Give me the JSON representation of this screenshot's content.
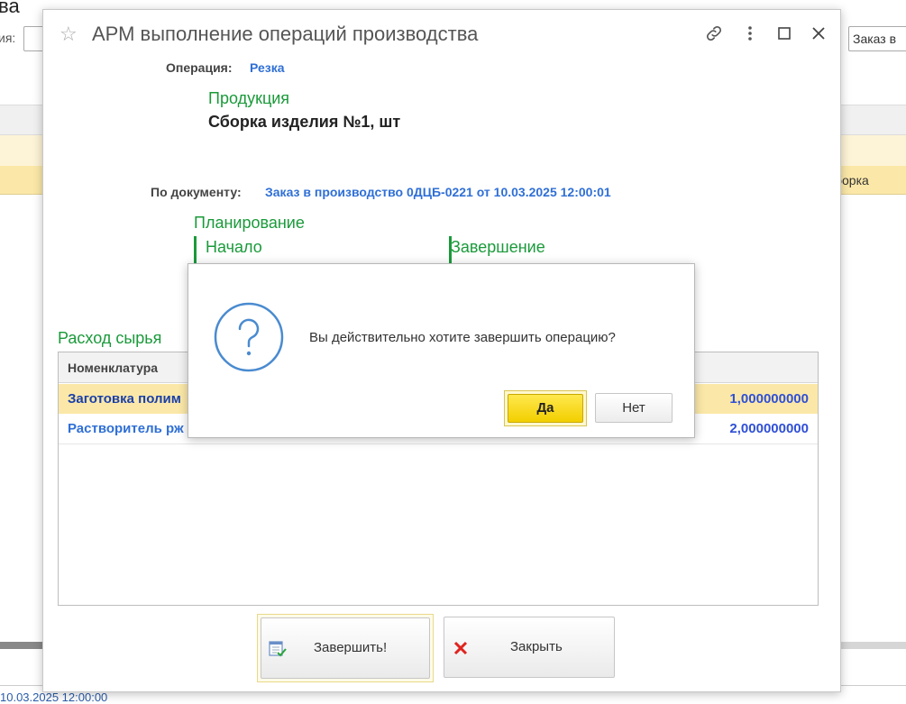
{
  "background": {
    "title_fragment": "ва",
    "label_fragment": "ия:",
    "right_input_value": "Заказ в",
    "row_text_fragment": "борка",
    "bottom_text_fragment": "10.03.2025 12:00:00"
  },
  "window": {
    "title": "АРМ выполнение операций производства",
    "operation": {
      "label": "Операция:",
      "value": "Резка"
    },
    "product": {
      "label": "Продукция",
      "value": "Сборка изделия №1, шт"
    },
    "document": {
      "label": "По документу:",
      "value": "Заказ в производство 0ДЦБ-0221 от 10.03.2025 12:00:01"
    },
    "planning": {
      "label": "Планирование",
      "start_label": "Начало",
      "end_label": "Завершение"
    },
    "raw": {
      "label": "Расход сырья",
      "columns": [
        "Номенклатура"
      ],
      "rows": [
        {
          "name": "Заготовка полим",
          "qty": "1,000000000"
        },
        {
          "name": "Растворитель рж",
          "qty": "2,000000000"
        }
      ]
    },
    "buttons": {
      "finish": "Завершить!",
      "close": "Закрыть"
    }
  },
  "dialog": {
    "message": "Вы действительно хотите завершить операцию?",
    "yes": "Да",
    "no": "Нет"
  },
  "colors": {
    "accent_green": "#1a9a3a",
    "link_blue": "#2f6fd6",
    "selected_row": "#fbe8a8",
    "yes_button": "#f2cf00"
  }
}
